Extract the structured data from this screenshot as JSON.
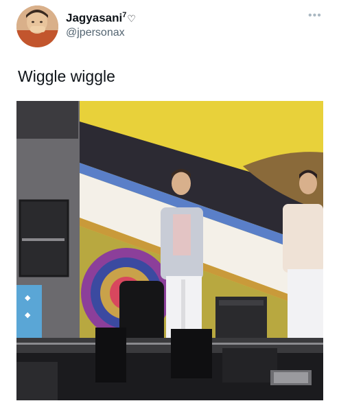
{
  "tweet": {
    "display_name": "Jagyasani",
    "name_superscript": "7",
    "name_emoji": "♡",
    "handle": "@jpersonax",
    "text": "Wiggle wiggle",
    "more_icon": "more-dots-icon"
  },
  "media": {
    "type": "video",
    "description_icon": "concert-stage-image"
  },
  "colors": {
    "name": "#0f1419",
    "handle": "#536471",
    "stage_yellow": "#e8d13a",
    "stage_dark": "#1a1a1c"
  }
}
